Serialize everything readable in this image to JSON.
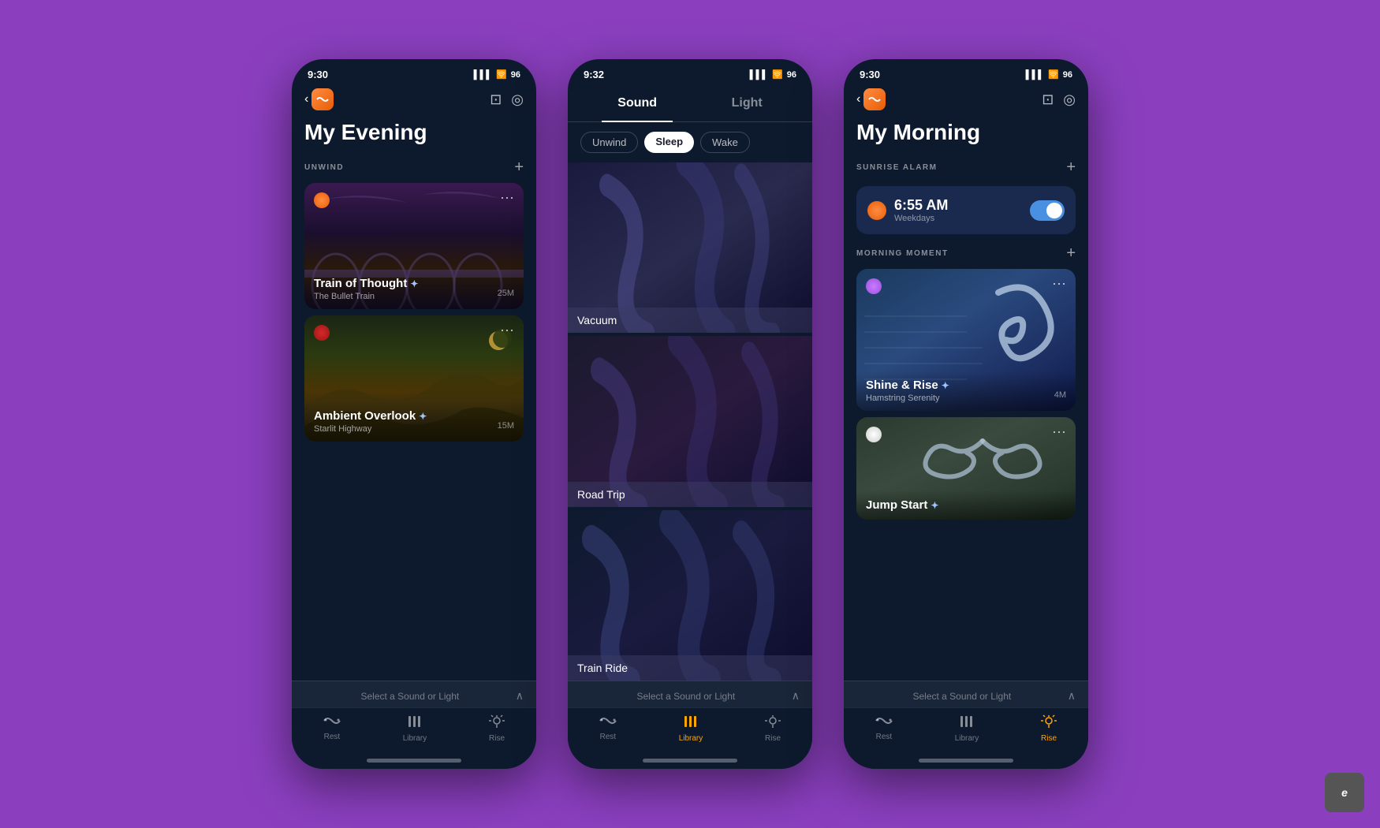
{
  "background": "#8B3FBF",
  "screens": [
    {
      "id": "evening",
      "status_time": "9:30",
      "battery": "96",
      "title": "My Evening",
      "section1": {
        "label": "UNWIND",
        "cards": [
          {
            "title": "Train of Thought",
            "subtitle": "The Bullet Train",
            "duration": "25M",
            "dot_color": "orange",
            "starred": true
          },
          {
            "title": "Ambient Overlook",
            "subtitle": "Starlit Highway",
            "duration": "15M",
            "dot_color": "red",
            "starred": true
          }
        ]
      },
      "bottom_label": "Select a Sound or Light",
      "tabs": [
        {
          "label": "Rest",
          "active": false
        },
        {
          "label": "Library",
          "active": false
        },
        {
          "label": "Rise",
          "active": false
        }
      ]
    },
    {
      "id": "library",
      "status_time": "9:32",
      "battery": "96",
      "tab_sound": "Sound",
      "tab_light": "Light",
      "filters": [
        "Unwind",
        "Sleep",
        "Wake"
      ],
      "active_filter": "Sleep",
      "sounds": [
        {
          "label": "Vacuum"
        },
        {
          "label": "Road Trip"
        },
        {
          "label": "Train Ride"
        }
      ],
      "bottom_label": "Select a Sound or Light",
      "tabs": [
        {
          "label": "Rest",
          "active": false
        },
        {
          "label": "Library",
          "active": true
        },
        {
          "label": "Rise",
          "active": false
        }
      ]
    },
    {
      "id": "morning",
      "status_time": "9:30",
      "battery": "96",
      "title": "My Morning",
      "section1": {
        "label": "SUNRISE ALARM",
        "alarm": {
          "time": "6:55 AM",
          "days": "Weekdays",
          "enabled": true
        }
      },
      "section2": {
        "label": "MORNING MOMENT",
        "cards": [
          {
            "title": "Shine & Rise",
            "subtitle": "Hamstring Serenity",
            "duration": "4M",
            "dot_color": "purple",
            "starred": true
          },
          {
            "title": "Jump Start",
            "subtitle": "",
            "duration": "",
            "dot_color": "white",
            "starred": true
          }
        ]
      },
      "bottom_label": "Select a Sound or Light",
      "tabs": [
        {
          "label": "Rest",
          "active": false
        },
        {
          "label": "Library",
          "active": false
        },
        {
          "label": "Rise",
          "active": true
        }
      ]
    }
  ],
  "icons": {
    "back_arrow": "‹",
    "message": "💬",
    "settings": "⚙",
    "more": "···",
    "plus": "+",
    "star": "✦",
    "chevron_up": "∧",
    "rest_icon": "👁",
    "library_icon": "|||",
    "rise_icon": "☀"
  }
}
